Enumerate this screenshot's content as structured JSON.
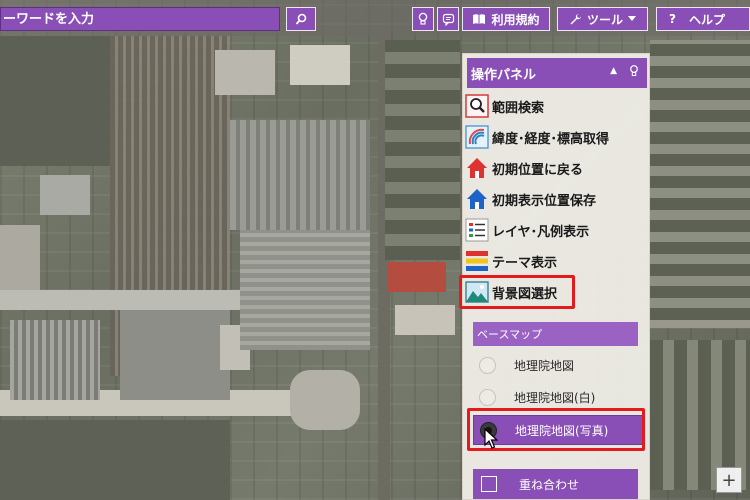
{
  "search": {
    "placeholder": "ーワードを入力"
  },
  "toolbar": {
    "search_button_icon": "magnifier-icon",
    "terms_label": "利用規約",
    "tools_label": "ツール",
    "help_label": "ヘルプ"
  },
  "panel": {
    "title": "操作パネル",
    "items": [
      {
        "label": "範囲検索",
        "icon": "range-search-icon"
      },
      {
        "label": "緯度･経度･標高取得",
        "icon": "latlon-elevation-icon"
      },
      {
        "label": "初期位置に戻る",
        "icon": "home-red-icon"
      },
      {
        "label": "初期表示位置保存",
        "icon": "home-blue-icon"
      },
      {
        "label": "レイヤ･凡例表示",
        "icon": "layer-legend-icon"
      },
      {
        "label": "テーマ表示",
        "icon": "theme-icon"
      },
      {
        "label": "背景図選択",
        "icon": "basemap-picture-icon"
      }
    ],
    "basemap": {
      "header": "ベースマップ",
      "options": [
        {
          "label": "地理院地図",
          "selected": false
        },
        {
          "label": "地理院地図(白)",
          "selected": false
        },
        {
          "label": "地理院地図(写真)",
          "selected": true
        }
      ]
    },
    "overlay_label": "重ね合わせ"
  },
  "map": {
    "zoom_in_label": "+"
  },
  "colors": {
    "accent": "#8a4fb6",
    "highlight": "#e21c1c"
  }
}
